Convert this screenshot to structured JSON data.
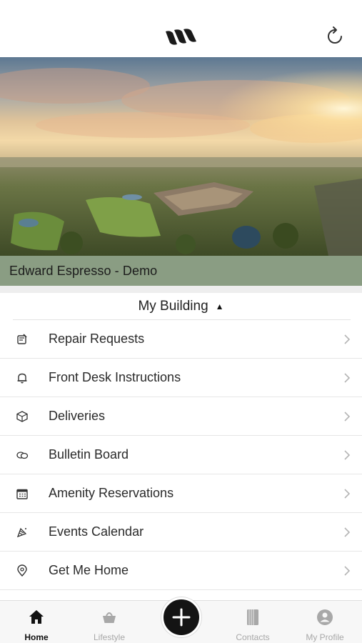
{
  "header": {
    "logo_icon": "brand-wave-logo",
    "refresh_icon": "refresh-icon"
  },
  "hero": {
    "image_desc_icon": "aerial-landscape-photo",
    "building_name": "Edward Espresso - Demo",
    "banner_color": "#8a9d83"
  },
  "section": {
    "title": "My Building",
    "caret": "▲"
  },
  "menu": {
    "items": [
      {
        "label": "Repair Requests",
        "icon": "repair-icon"
      },
      {
        "label": "Front Desk Instructions",
        "icon": "bell-icon"
      },
      {
        "label": "Deliveries",
        "icon": "package-icon"
      },
      {
        "label": "Bulletin Board",
        "icon": "chat-bubbles-icon"
      },
      {
        "label": "Amenity Reservations",
        "icon": "calendar-icon"
      },
      {
        "label": "Events Calendar",
        "icon": "party-icon"
      },
      {
        "label": "Get Me Home",
        "icon": "location-pin-icon"
      }
    ]
  },
  "bottom_nav": {
    "items": [
      {
        "label": "Home",
        "icon": "home-icon",
        "active": true
      },
      {
        "label": "Lifestyle",
        "icon": "basket-icon",
        "active": false
      },
      {
        "label": "Contacts",
        "icon": "address-book-icon",
        "active": false
      },
      {
        "label": "My Profile",
        "icon": "profile-icon",
        "active": false
      }
    ],
    "fab_icon": "plus-icon"
  },
  "colors": {
    "accent_dark": "#141414",
    "inactive_nav": "#a8a8a8"
  }
}
